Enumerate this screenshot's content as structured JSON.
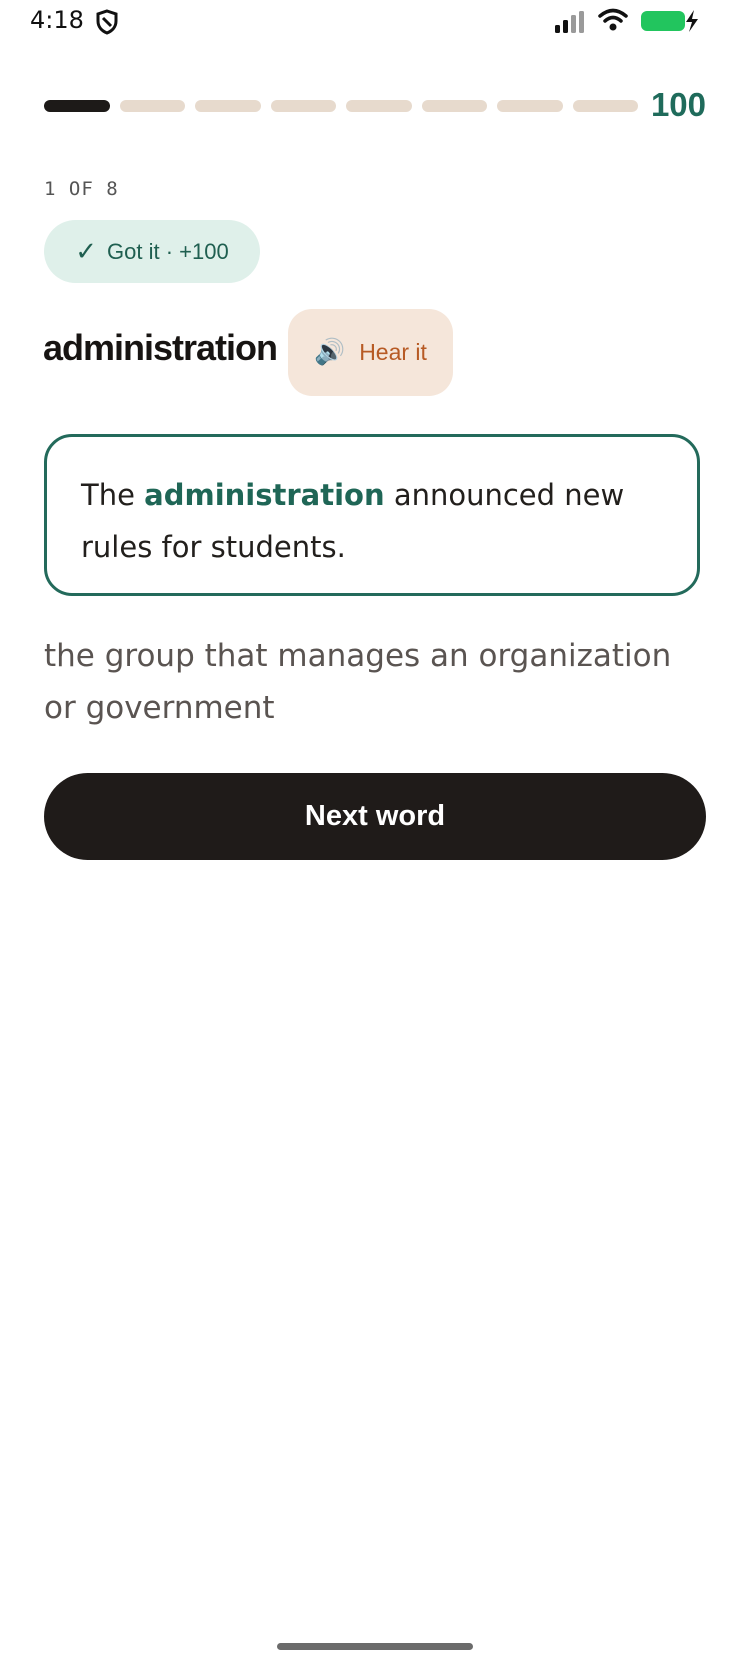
{
  "status_bar": {
    "time": "4:18"
  },
  "progress": {
    "total_steps": 8,
    "current_step": 1,
    "score": "100"
  },
  "counter": "1 OF 8",
  "feedback_badge": {
    "icon": "check-icon",
    "text": "Got it · +100"
  },
  "word": "administration",
  "hear_button": {
    "icon": "speaker-icon",
    "label": "Hear it"
  },
  "example": {
    "before": "The ",
    "highlight": "administration",
    "after": " announced new rules for students."
  },
  "definition": "the group that manages an organization or government",
  "next_button": "Next word",
  "colors": {
    "accent": "#1f6b5b",
    "button_bg": "#1f1b19",
    "hear_bg": "#f5e6da",
    "badge_bg": "#dff0ea",
    "progress_inactive": "#e7dacd"
  }
}
